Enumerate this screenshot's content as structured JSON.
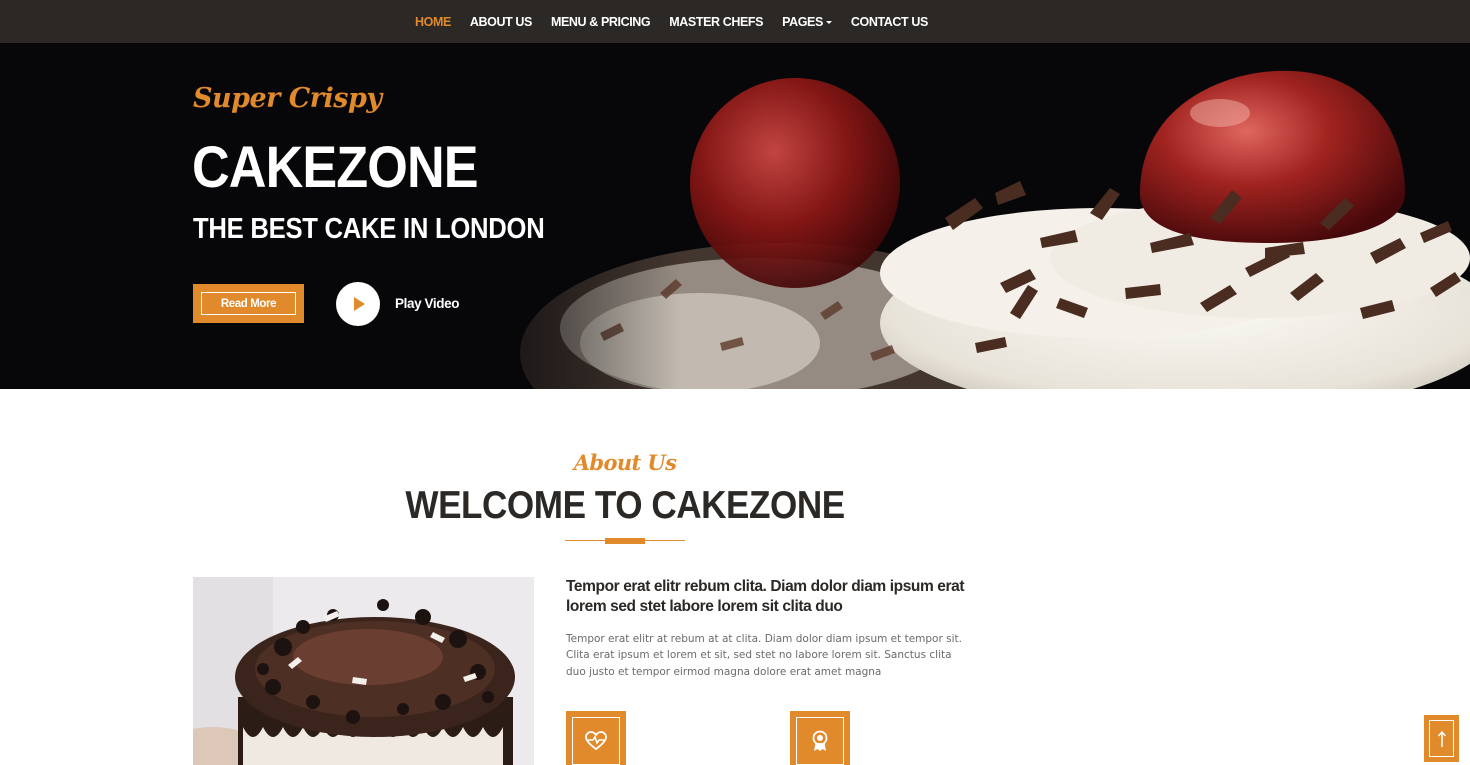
{
  "nav": {
    "items": [
      {
        "label": "HOME",
        "active": true
      },
      {
        "label": "ABOUT US"
      },
      {
        "label": "MENU & PRICING"
      },
      {
        "label": "MASTER CHEFS"
      },
      {
        "label": "PAGES",
        "dropdown": true
      },
      {
        "label": "CONTACT US"
      }
    ]
  },
  "hero": {
    "tagline": "Super Crispy",
    "title": "CAKEZONE",
    "subtitle": "THE BEST CAKE IN LONDON",
    "read_more_label": "Read More",
    "play_label": "Play Video",
    "play_icon": "play-icon"
  },
  "about": {
    "script_label": "About Us",
    "title": "WELCOME TO CAKEZONE",
    "lead": "Tempor erat elitr rebum clita. Diam dolor diam ipsum erat lorem sed stet labore lorem sit clita duo",
    "body": "Tempor erat elitr at rebum at at clita. Diam dolor diam ipsum et tempor sit. Clita erat ipsum et lorem et sit, sed stet no labore lorem sit. Sanctus clita duo justo et tempor eirmod magna dolore erat amet magna",
    "features": [
      {
        "icon": "heartbeat-icon"
      },
      {
        "icon": "award-icon"
      }
    ]
  },
  "back_to_top": {
    "icon": "arrow-up-icon"
  },
  "colors": {
    "accent": "#e08a2c",
    "dark": "#2b2825",
    "hero_bg": "#07070a"
  }
}
